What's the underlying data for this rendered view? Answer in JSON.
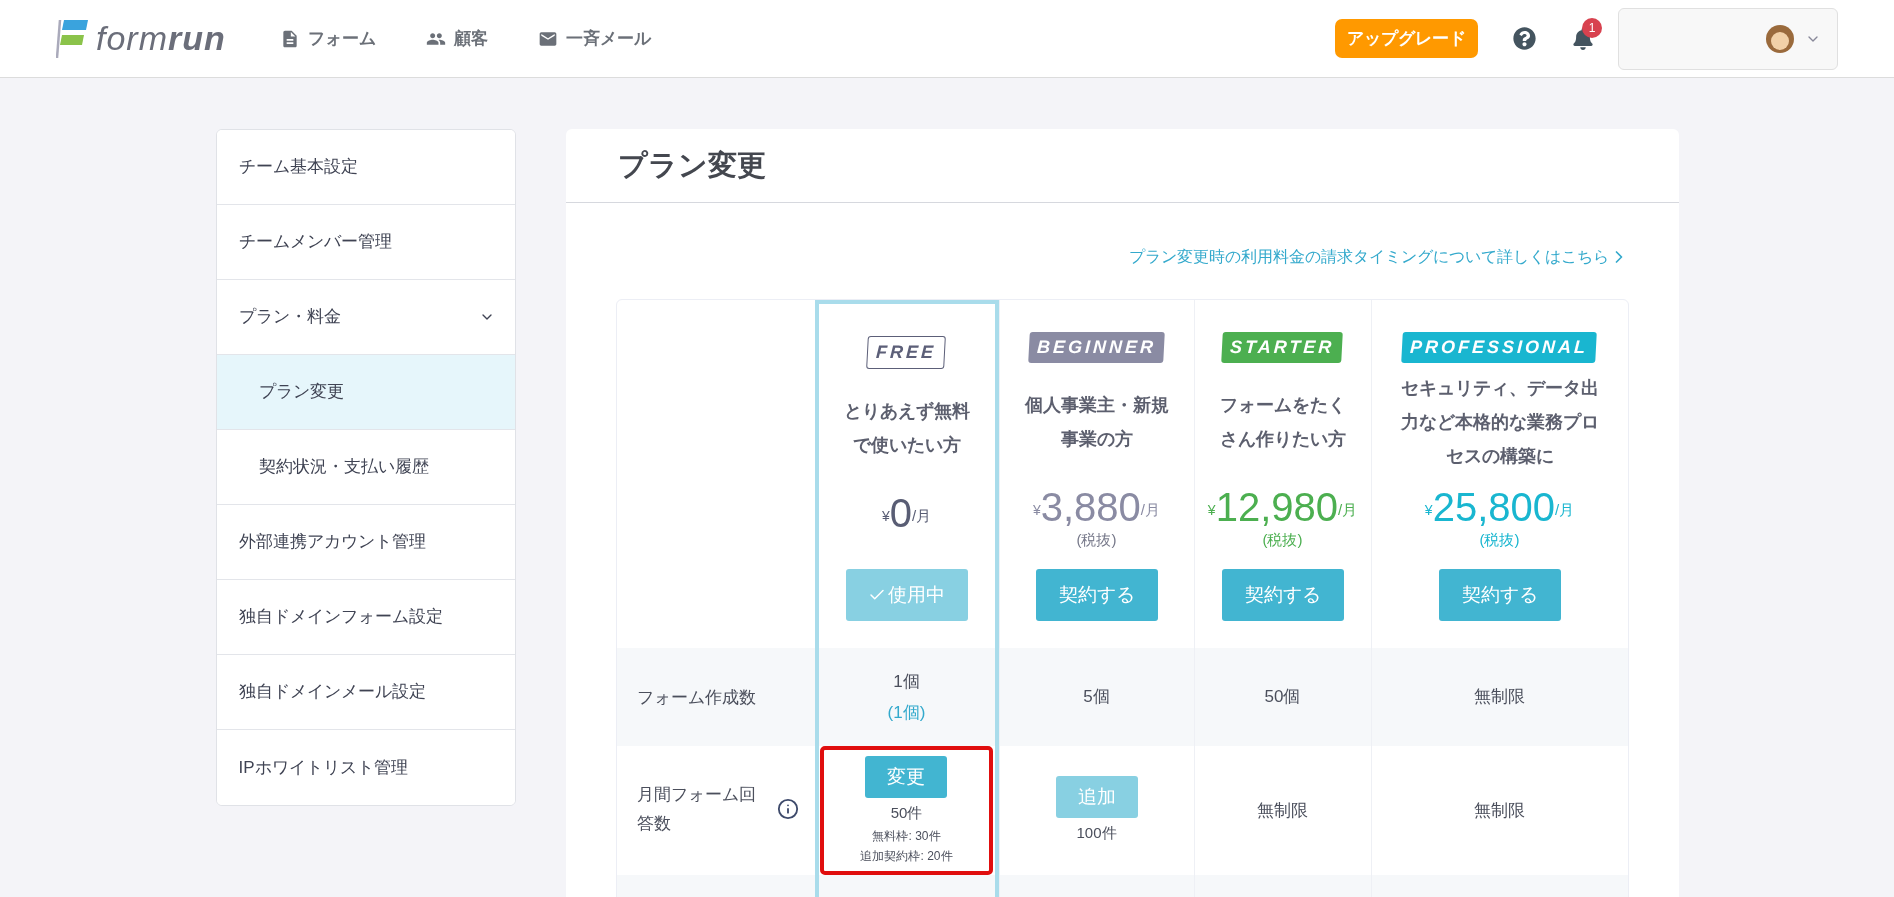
{
  "header": {
    "logo": "form**run**",
    "nav": [
      {
        "label": "フォーム"
      },
      {
        "label": "顧客"
      },
      {
        "label": "一斉メール"
      }
    ],
    "upgrade": "アップグレード",
    "notifications": "1"
  },
  "sidebar": {
    "items": [
      {
        "label": "チーム基本設定",
        "selected": false
      },
      {
        "label": "チームメンバー管理",
        "selected": false
      },
      {
        "label": "プラン・料金",
        "selected": false,
        "expanded": true,
        "children": [
          {
            "label": "プラン変更",
            "selected": true
          },
          {
            "label": "契約状況・支払い履歴",
            "selected": false
          }
        ]
      },
      {
        "label": "外部連携アカウント管理",
        "selected": false
      },
      {
        "label": "独自ドメインフォーム設定",
        "selected": false
      },
      {
        "label": "独自ドメインメール設定",
        "selected": false
      },
      {
        "label": "IPホワイトリスト管理",
        "selected": false
      }
    ]
  },
  "page": {
    "title": "プラン変更",
    "link": "プラン変更時の利用料金の請求タイミングについて詳しくはこちら"
  },
  "plans": [
    {
      "tag": "FREE",
      "kind": "outline",
      "color": "#5c5f78",
      "current": true,
      "description": "とりあえず無料で使いたい方",
      "currency": "¥",
      "price": "0",
      "per": "/月",
      "button": "使用中"
    },
    {
      "tag": "BEGINNER",
      "kind": "filled",
      "color": "#8a8ba3",
      "current": false,
      "description": "個人事業主・新規事業の方",
      "currency": "¥",
      "price": "3,880",
      "per": "/月",
      "tax": "(税抜)",
      "button": "契約する"
    },
    {
      "tag": "STARTER",
      "kind": "filled",
      "color": "#4caf50",
      "current": false,
      "description": "フォームをたくさん作りたい方",
      "currency": "¥",
      "price": "12,980",
      "per": "/月",
      "tax": "(税抜)",
      "button": "契約する"
    },
    {
      "tag": "PROFESSIONAL",
      "kind": "filled",
      "color": "#19b6d0",
      "current": false,
      "description": "セキュリティ、データ出力など本格的な業務プロセスの構築に",
      "currency": "¥",
      "price": "25,800",
      "per": "/月",
      "tax": "(税抜)",
      "button": "契約する"
    }
  ],
  "rows": [
    {
      "label": "フォーム作成数",
      "info": false,
      "cells": [
        {
          "kind": "text",
          "text": "1個",
          "note": "(1個)"
        },
        {
          "kind": "text",
          "text": "5個"
        },
        {
          "kind": "text",
          "text": "50個"
        },
        {
          "kind": "text",
          "text": "無制限"
        }
      ]
    },
    {
      "label": "月間フォーム回答数",
      "info": true,
      "cells": [
        {
          "kind": "action",
          "button": "変更",
          "disabled": false,
          "highlighted": true,
          "lines": [
            "50件",
            "無料枠: 30件",
            "追加契約枠: 20件"
          ]
        },
        {
          "kind": "action",
          "button": "追加",
          "disabled": true,
          "highlighted": false,
          "lines": [
            "100件"
          ]
        },
        {
          "kind": "text",
          "text": "無制限"
        },
        {
          "kind": "text",
          "text": "無制限"
        }
      ]
    }
  ]
}
